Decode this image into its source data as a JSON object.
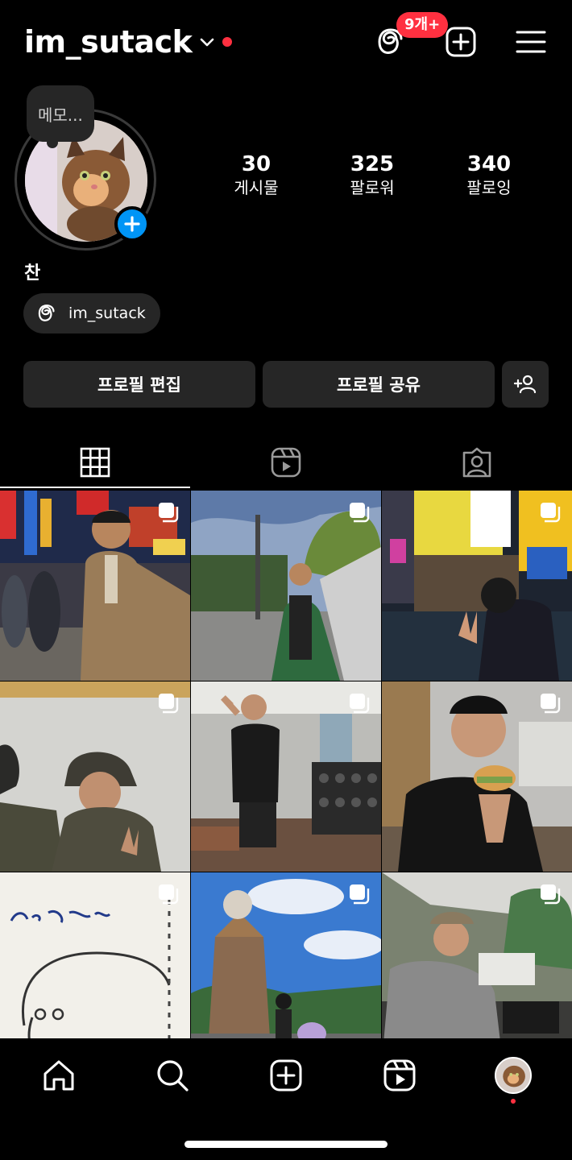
{
  "header": {
    "username": "im_sutack",
    "threads_badge": "9개+",
    "icons": [
      "threads-icon",
      "create-icon",
      "menu-icon"
    ]
  },
  "profile": {
    "note": "메모...",
    "display_name": "찬",
    "threads_handle": "im_sutack",
    "stats": [
      {
        "count": "30",
        "label": "게시물"
      },
      {
        "count": "325",
        "label": "팔로워"
      },
      {
        "count": "340",
        "label": "팔로잉"
      }
    ]
  },
  "actions": {
    "edit_profile": "프로필 편집",
    "share_profile": "프로필 공유"
  },
  "tabs": [
    "grid-icon",
    "reels-icon",
    "tagged-icon"
  ],
  "grid": {
    "posts": [
      {
        "name": "post-night-street",
        "multi": true
      },
      {
        "name": "post-temple-road",
        "multi": true
      },
      {
        "name": "post-city-neon",
        "multi": true
      },
      {
        "name": "post-military-hats",
        "multi": true
      },
      {
        "name": "post-gym",
        "multi": true
      },
      {
        "name": "post-cafe-burger",
        "multi": true
      },
      {
        "name": "post-sketch-text",
        "multi": true
      },
      {
        "name": "post-theme-park",
        "multi": true
      },
      {
        "name": "post-restaurant-laptop",
        "multi": true
      }
    ]
  },
  "bottom_nav": [
    "home-icon",
    "search-icon",
    "create-icon",
    "reels-icon",
    "profile-avatar"
  ],
  "colors": {
    "background": "#000000",
    "button": "#262626",
    "accent_blue": "#0095f6",
    "notification_red": "#ff3040"
  }
}
